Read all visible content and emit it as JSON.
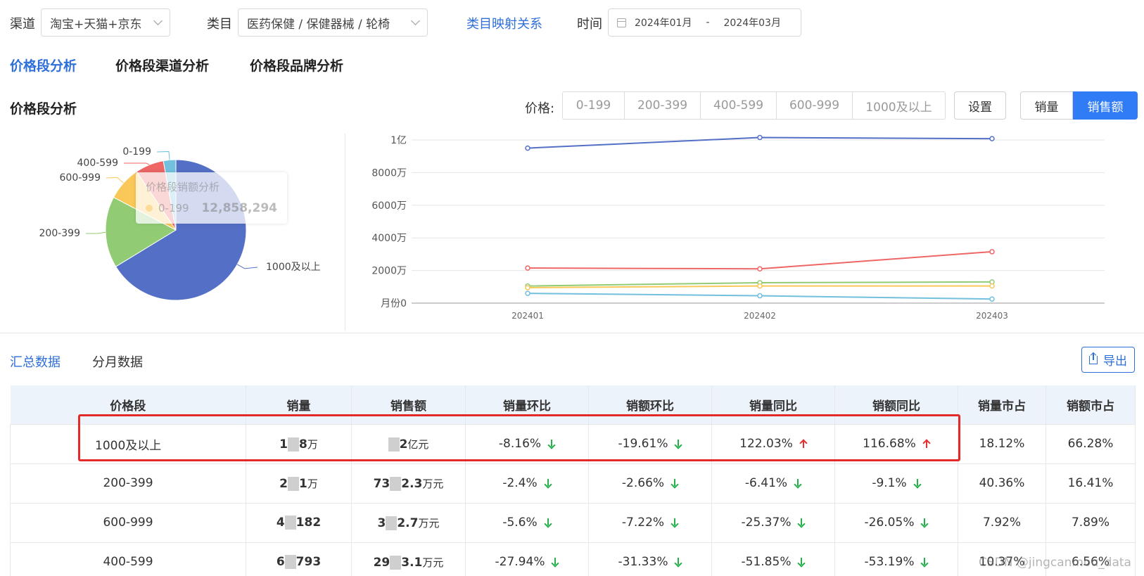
{
  "filters": {
    "channel_label": "渠道",
    "channel_value": "淘宝+天猫+京东",
    "category_label": "类目",
    "category_value": "医药保健 / 保健器械 / 轮椅",
    "mapping_link": "类目映射关系",
    "time_label": "时间",
    "date_start": "2024年01月",
    "date_sep": "-",
    "date_end": "2024年03月"
  },
  "main_tabs": [
    "价格段分析",
    "价格段渠道分析",
    "价格段品牌分析"
  ],
  "section": {
    "title": "价格段分析",
    "price_label": "价格:",
    "price_segments": [
      "0-199",
      "200-399",
      "400-599",
      "600-999",
      "1000及以上"
    ],
    "settings_btn": "设置",
    "toggle_volume": "销量",
    "toggle_sales": "销售额"
  },
  "pie": {
    "tooltip_title": "价格段销额分析",
    "tooltip_label": "0-199",
    "tooltip_value": "12,858,294",
    "labels": [
      "0-199",
      "400-599",
      "600-999",
      "200-399",
      "1000及以上"
    ]
  },
  "chart_data": [
    {
      "type": "pie",
      "categories": [
        "1000及以上",
        "200-399",
        "600-999",
        "400-599",
        "0-199"
      ],
      "values": [
        66.28,
        16.41,
        7.89,
        6.56,
        2.86
      ],
      "colors": [
        "#5470c6",
        "#91cc75",
        "#fac858",
        "#ee6666",
        "#73c0de"
      ]
    },
    {
      "type": "line",
      "x": [
        "202401",
        "202402",
        "202403"
      ],
      "y_ticks": [
        "月份0",
        "2000万",
        "4000万",
        "6000万",
        "8000万",
        "1亿"
      ],
      "ylim": [
        0,
        10000
      ],
      "series": [
        {
          "values": [
            9500,
            10150,
            10080
          ],
          "color": "#5470c6"
        },
        {
          "values": [
            2150,
            2100,
            3150
          ],
          "color": "#ee6666"
        },
        {
          "values": [
            1050,
            1250,
            1300
          ],
          "color": "#91cc75"
        },
        {
          "values": [
            950,
            1050,
            1050
          ],
          "color": "#fac858"
        },
        {
          "values": [
            600,
            450,
            250
          ],
          "color": "#73c0de"
        }
      ]
    }
  ],
  "sub_tabs": [
    "汇总数据",
    "分月数据"
  ],
  "export_label": "导出",
  "table": {
    "headers": [
      "价格段",
      "销量",
      "销售额",
      "销量环比",
      "销额环比",
      "销量同比",
      "销额同比",
      "销量市占",
      "销额市占"
    ],
    "rows": [
      {
        "segment": "1000及以上",
        "vol_a": "1",
        "vol_b": "8",
        "vol_unit": "万",
        "sales_a": "",
        "sales_b": "2",
        "sales_unit": "亿元",
        "vol_mom": "-8.16%",
        "sales_mom": "-19.61%",
        "vol_yoy": "122.03%",
        "sales_yoy": "116.68%",
        "vol_share": "18.12%",
        "sales_share": "66.28%"
      },
      {
        "segment": "200-399",
        "vol_a": "2",
        "vol_b": "1",
        "vol_unit": "万",
        "sales_a": "73",
        "sales_b": "2.3",
        "sales_unit": "万元",
        "vol_mom": "-2.4%",
        "sales_mom": "-2.66%",
        "vol_yoy": "-6.41%",
        "sales_yoy": "-9.1%",
        "vol_share": "40.36%",
        "sales_share": "16.41%"
      },
      {
        "segment": "600-999",
        "vol_a": "4",
        "vol_b": "182",
        "vol_unit": "",
        "sales_a": "3",
        "sales_b": "2.7",
        "sales_unit": "万元",
        "vol_mom": "-5.6%",
        "sales_mom": "-7.22%",
        "vol_yoy": "-25.37%",
        "sales_yoy": "-26.05%",
        "vol_share": "7.92%",
        "sales_share": "7.89%"
      },
      {
        "segment": "400-599",
        "vol_a": "6",
        "vol_b": "793",
        "vol_unit": "",
        "sales_a": "29",
        "sales_b": "3.1",
        "sales_unit": "万元",
        "vol_mom": "-27.94%",
        "sales_mom": "-31.33%",
        "vol_yoy": "-51.85%",
        "sales_yoy": "-53.19%",
        "vol_share": "10.37%",
        "sales_share": "6.56%"
      }
    ]
  },
  "watermark": "CSDN @jingcanmou_data"
}
